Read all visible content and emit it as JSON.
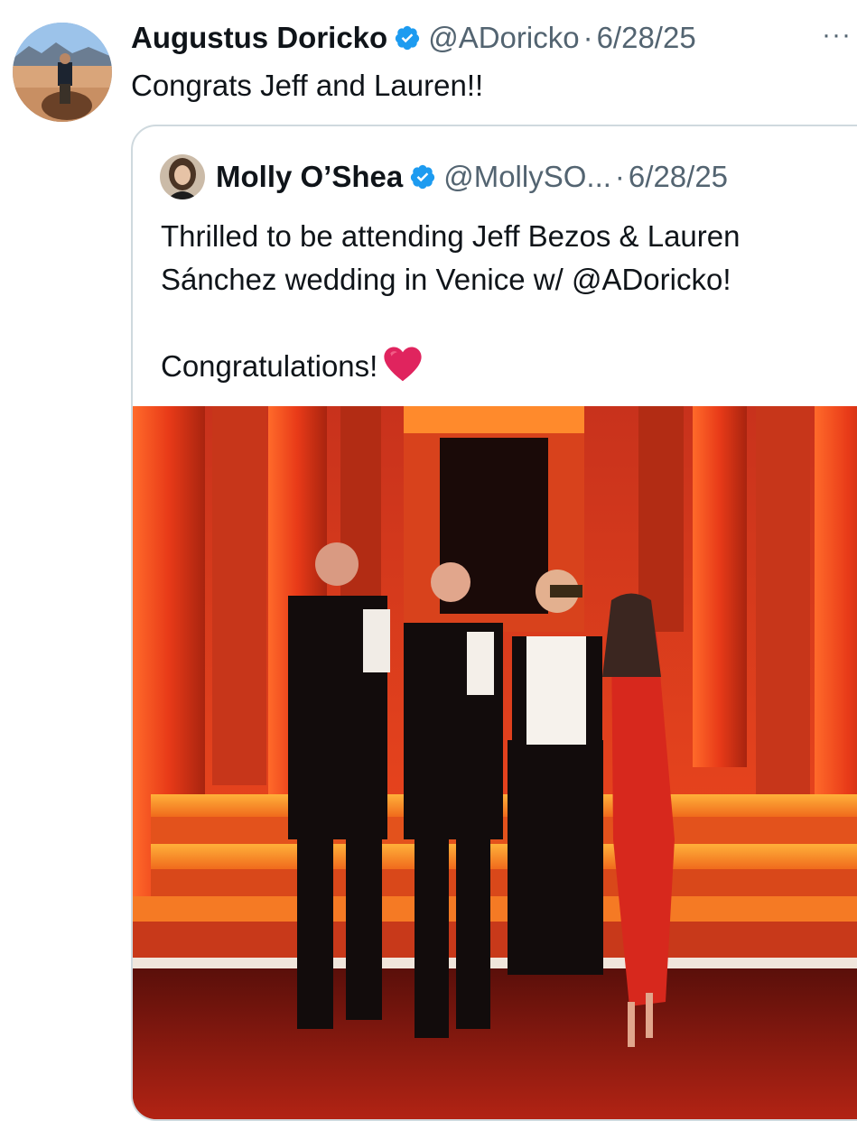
{
  "tweet": {
    "author_name": "Augustus Doricko",
    "handle": "@ADoricko",
    "separator": "·",
    "date": "6/28/25",
    "more_label": "···",
    "text": "Congrats Jeff and Lauren!!"
  },
  "quoted": {
    "author_name": "Molly O’Shea",
    "handle": "@MollySO...",
    "separator": "·",
    "date": "6/28/25",
    "line1": "Thrilled to be attending Jeff Bezos & Lauren",
    "line2": "Sánchez wedding in Venice w/ @ADoricko!",
    "line3": "Congratulations!"
  },
  "colors": {
    "verified_blue": "#1d9bf0",
    "secondary_text": "#536471",
    "border": "#cfd9de",
    "heart": "#e0245e"
  },
  "icons": {
    "verified": "verified-badge-icon",
    "heart": "red-heart-icon",
    "more": "more-options-icon"
  }
}
